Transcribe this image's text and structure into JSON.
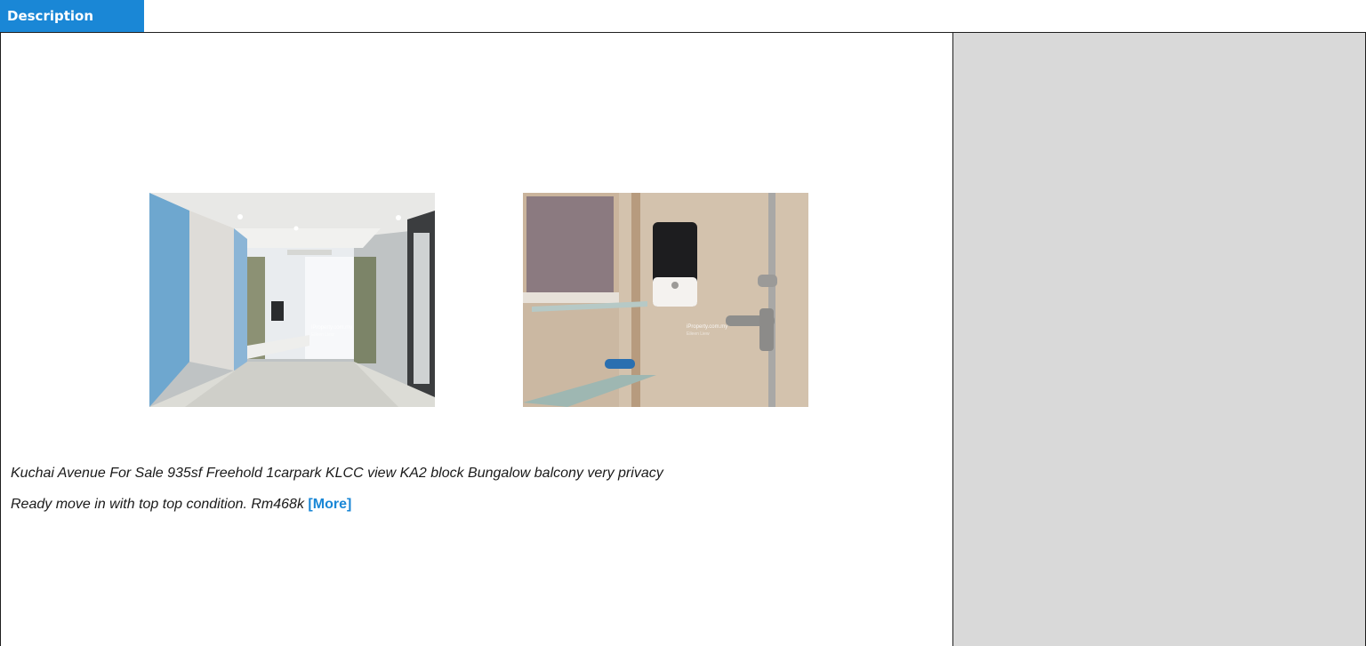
{
  "header": {
    "tab_label": "Description"
  },
  "photos": [
    {
      "watermark": "iProperty.com.my",
      "agent": "Eileen Liew"
    },
    {
      "watermark": "iProperty.com.my",
      "agent": "Eileen Liew"
    }
  ],
  "description": {
    "line1": "Kuchai Avenue For Sale  935sf Freehold 1carpark KLCC view  KA2 block Bungalow balcony very privacy",
    "line2": "Ready move in with top top condition.   Rm468k ",
    "more_label": "[More]"
  },
  "colors": {
    "accent": "#1a87d6",
    "sidebar": "#d9d9d9",
    "text": "#1a1a1a"
  }
}
